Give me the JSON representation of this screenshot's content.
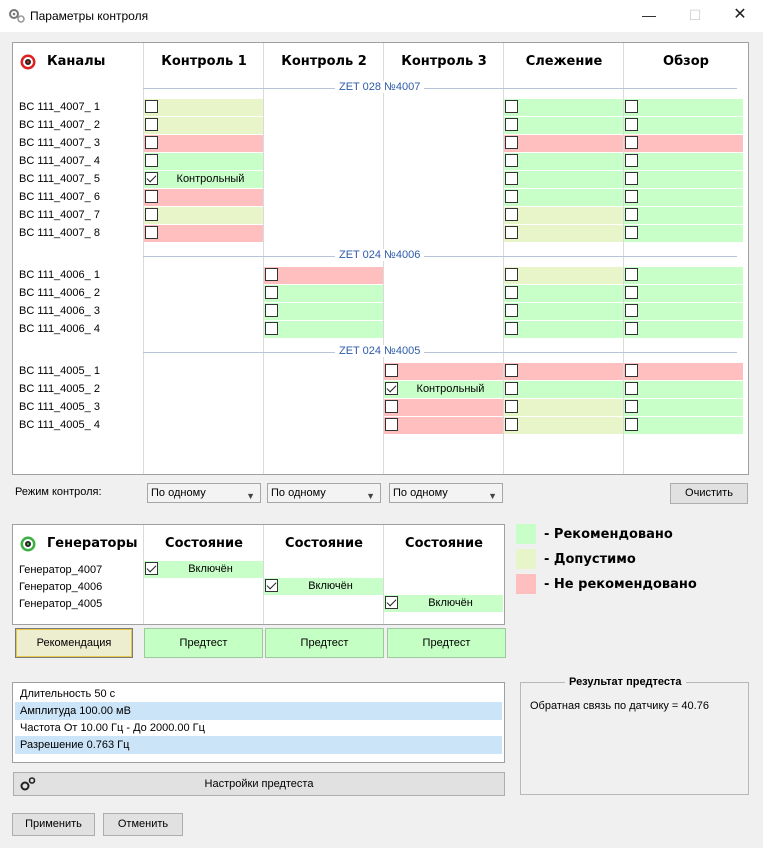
{
  "window": {
    "title": "Параметры контроля"
  },
  "channels": {
    "header": {
      "channels": "Каналы",
      "control1": "Контроль 1",
      "control2": "Контроль 2",
      "control3": "Контроль 3",
      "tracking": "Слежение",
      "overview": "Обзор"
    },
    "groups": [
      {
        "title": "ZET 028 №4007",
        "rows": [
          {
            "label": "BC 111_4007_ 1",
            "col": 0,
            "checked": false,
            "status": "y",
            "text": "",
            "track": "g",
            "overview": "g"
          },
          {
            "label": "BC 111_4007_ 2",
            "col": 0,
            "checked": false,
            "status": "y",
            "text": "",
            "track": "g",
            "overview": "g"
          },
          {
            "label": "BC 111_4007_ 3",
            "col": 0,
            "checked": false,
            "status": "r",
            "text": "",
            "track": "r",
            "overview": "r"
          },
          {
            "label": "BC 111_4007_ 4",
            "col": 0,
            "checked": false,
            "status": "g",
            "text": "",
            "track": "g",
            "overview": "g"
          },
          {
            "label": "BC 111_4007_ 5",
            "col": 0,
            "checked": true,
            "status": "g",
            "text": "Контрольный",
            "track": "g",
            "overview": "g"
          },
          {
            "label": "BC 111_4007_ 6",
            "col": 0,
            "checked": false,
            "status": "r",
            "text": "",
            "track": "g",
            "overview": "g"
          },
          {
            "label": "BC 111_4007_ 7",
            "col": 0,
            "checked": false,
            "status": "y",
            "text": "",
            "track": "y",
            "overview": "g"
          },
          {
            "label": "BC 111_4007_ 8",
            "col": 0,
            "checked": false,
            "status": "r",
            "text": "",
            "track": "y",
            "overview": "g"
          }
        ]
      },
      {
        "title": "ZET 024 №4006",
        "rows": [
          {
            "label": "BC 111_4006_ 1",
            "col": 1,
            "checked": false,
            "status": "r",
            "text": "",
            "track": "y",
            "overview": "g"
          },
          {
            "label": "BC 111_4006_ 2",
            "col": 1,
            "checked": false,
            "status": "g",
            "text": "",
            "track": "g",
            "overview": "g"
          },
          {
            "label": "BC 111_4006_ 3",
            "col": 1,
            "checked": false,
            "status": "g",
            "text": "",
            "track": "g",
            "overview": "g"
          },
          {
            "label": "BC 111_4006_ 4",
            "col": 1,
            "checked": false,
            "status": "g",
            "text": "",
            "track": "g",
            "overview": "g"
          }
        ]
      },
      {
        "title": "ZET 024 №4005",
        "rows": [
          {
            "label": "BC 111_4005_ 1",
            "col": 2,
            "checked": false,
            "status": "r",
            "text": "",
            "track": "r",
            "overview": "r"
          },
          {
            "label": "BC 111_4005_ 2",
            "col": 2,
            "checked": true,
            "status": "g",
            "text": "Контрольный",
            "track": "g",
            "overview": "g"
          },
          {
            "label": "BC 111_4005_ 3",
            "col": 2,
            "checked": false,
            "status": "r",
            "text": "",
            "track": "y",
            "overview": "g"
          },
          {
            "label": "BC 111_4005_ 4",
            "col": 2,
            "checked": false,
            "status": "r",
            "text": "",
            "track": "y",
            "overview": "g"
          }
        ]
      }
    ]
  },
  "mode": {
    "label": "Режим контроля:",
    "selects": [
      "По одному",
      "По одному",
      "По одному"
    ],
    "clear_button": "Очистить"
  },
  "generators": {
    "header": {
      "title": "Генераторы",
      "state1": "Состояние",
      "state2": "Состояние",
      "state3": "Состояние"
    },
    "rows": [
      {
        "label": "Генератор_4007",
        "col": 0,
        "checked": true,
        "text": "Включён"
      },
      {
        "label": "Генератор_4006",
        "col": 1,
        "checked": true,
        "text": "Включён"
      },
      {
        "label": "Генератор_4005",
        "col": 2,
        "checked": true,
        "text": "Включён"
      }
    ]
  },
  "legend": {
    "recommended": "- Рекомендовано",
    "acceptable": "- Допустимо",
    "not_recommended": "- Не рекомендовано",
    "colors": {
      "recommended": "#c8ffc8",
      "acceptable": "#e8f5c8",
      "not_recommended": "#ffbfbf"
    }
  },
  "buttons": {
    "recommendation": "Рекомендация",
    "pretest": [
      "Предтест",
      "Предтест",
      "Предтест"
    ],
    "pretest_settings": "Настройки предтеста",
    "apply": "Применить",
    "cancel": "Отменить"
  },
  "info": {
    "rows": [
      "Длительность 50 с",
      "Амплитуда 100.00 мВ",
      "Частота От 10.00 Гц - До 2000.00 Гц",
      "Разрешение 0.763 Гц"
    ]
  },
  "result": {
    "title": "Результат предтеста",
    "text": "Обратная связь по датчику = 40.76"
  }
}
